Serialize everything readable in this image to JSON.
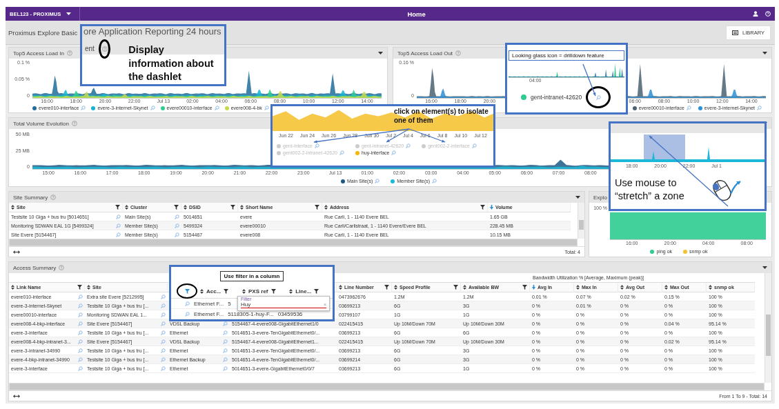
{
  "top_bar": {
    "account": "BEL123 - PROXIMUS",
    "title": "Home"
  },
  "page_header": {
    "title": "Proximus Explore Basic",
    "library_button": "LIBRARY"
  },
  "load_charts": [
    {
      "title": "Top5 Access Load In",
      "y_ticks": [
        "0.1 %",
        "0.05 %",
        "0"
      ],
      "x_ticks": [
        "16:00",
        "18:00",
        "20:00",
        "22:00",
        "Jul 13",
        "02:00",
        "04:00",
        "06:00",
        "08:00",
        "10:00",
        "12:00",
        "14:00"
      ],
      "legend": [
        {
          "label": "evere010-interface",
          "color": "#1f6e9c"
        },
        {
          "label": "evere-3-internet-Skynet",
          "color": "#17b3d1"
        },
        {
          "label": "evere00010-interface",
          "color": "#2ecc8f"
        },
        {
          "label": "evere008-4-bk",
          "color": "#c8da4c"
        }
      ]
    },
    {
      "title": "Top5 Access Load Out",
      "y_ticks": [
        "0.16 %",
        "0"
      ],
      "x_ticks": [
        "16:00",
        "18:00",
        "20:00",
        "06:00",
        "08:00",
        "10:00",
        "12:00",
        "14:00"
      ],
      "legend": [
        {
          "label": "evere00010-interface",
          "color": "#4a6272"
        },
        {
          "label": "evere-3-internet-Skynet",
          "color": "#2b8fd6"
        }
      ]
    }
  ],
  "volume_chart": {
    "title": "Total Volume Evolution",
    "y_ticks": [
      "50 MB",
      "25 MB",
      "0"
    ],
    "x_ticks": [
      "15:00",
      "16:00",
      "17:00",
      "18:00",
      "19:00",
      "20:00",
      "21:00",
      "22:00",
      "23:00",
      "Jul 13",
      "01:00",
      "02:00",
      "03:00",
      "04:00",
      "05:00",
      "06:00",
      "07:00",
      "08:00"
    ],
    "legend": [
      {
        "label": "Main Site(s)",
        "color": "#1c5a85"
      },
      {
        "label": "Member Site(s)",
        "color": "#1bb8d8"
      }
    ]
  },
  "site_summary": {
    "title": "Site Summary",
    "columns": [
      {
        "label": "Site",
        "sorted": false,
        "kind": "lookup"
      },
      {
        "label": "Cluster",
        "sorted": false,
        "kind": "lookup"
      },
      {
        "label": "DSID",
        "sorted": false,
        "kind": "filter"
      },
      {
        "label": "Short Name",
        "sorted": false,
        "kind": "filter"
      },
      {
        "label": "Address",
        "sorted": false,
        "kind": "filter"
      },
      {
        "label": "Volume",
        "sorted": true,
        "kind": "plain"
      }
    ],
    "rows": [
      [
        "Testsite 10 Giga + bus tru [5014651]",
        "Main Site(s)",
        "5014651",
        "evere",
        "Rue Carli, 1 - 1140 Evere BEL",
        "1.65 GB"
      ],
      [
        "Monitoring SDWAN EAL 1G [5499324]",
        "Member Site(s)",
        "5499324",
        "evere00010",
        "Rue Carli/Carlistraat, 1 - 1140 Evere/Evere BEL",
        "228.45 MB"
      ],
      [
        "Site Evere [5154467]",
        "Member Site(s)",
        "5154467",
        "evere008",
        "Rue Carli, 1 - 1140 Evere BEL",
        "10.15 MB"
      ]
    ],
    "footer": "Total: 4"
  },
  "explore_chart": {
    "title": "Explo",
    "y_ticks": [
      "100 %"
    ],
    "x_ticks": [
      "16:00",
      "20:00",
      "04:00",
      "08:00"
    ],
    "legend": [
      {
        "label": "ping ok",
        "color": "#2ecc8f"
      },
      {
        "label": "snmp ok",
        "color": "#f2c230"
      }
    ]
  },
  "access_summary": {
    "title": "Access Summary",
    "group_header": "Bandwidth Utilization % [Average, Maximum (peak)]",
    "columns": [
      {
        "label": "Link Name",
        "sorted": false,
        "kind": "lookup"
      },
      {
        "label": "Site",
        "sorted": false,
        "kind": "linked"
      },
      {
        "kind": "linked"
      },
      {
        "kind": "plain"
      },
      {
        "label": "Line Number",
        "sorted": false,
        "kind": "filter"
      },
      {
        "label": "Speed Profile",
        "sorted": false,
        "kind": "filter"
      },
      {
        "label": "Available BW",
        "sorted": false,
        "kind": "filter"
      },
      {
        "label": "Avg In",
        "sorted": true,
        "kind": "plain"
      },
      {
        "label": "Max In",
        "sorted": false,
        "kind": "plain"
      },
      {
        "label": "Avg Out",
        "sorted": false,
        "kind": "plain"
      },
      {
        "label": "Max Out",
        "sorted": false,
        "kind": "plain"
      },
      {
        "label": "snmp ok",
        "sorted": false,
        "kind": "plain"
      }
    ],
    "rows": [
      [
        "evere010-interface",
        "Extra site Evere [5212995]",
        null,
        null,
        "0473962676",
        "1.2M",
        "1.2M",
        "0.01 %",
        "0.07 %",
        "0.02 %",
        "0.15 %",
        "100 %"
      ],
      [
        "evere-3-internet-Skynet",
        "Testsite 10 Giga + bus tru [...",
        null,
        null,
        "03699213",
        "6G",
        "3G",
        "0 %",
        "0.01 %",
        "0 %",
        "0 %",
        "100 %"
      ],
      [
        "evere00010-interface",
        "Monitoring SDWAN EAL 1...",
        null,
        null,
        "03799107",
        "1G",
        "1G",
        "0 %",
        "0 %",
        "0 %",
        "0 %",
        "100 %"
      ],
      [
        "evere008-4-bkp-interface",
        "Site Evere [5154467]",
        "VDSL Backup",
        "5154467-4-evere008-GigabitEthernet1/0",
        "022415415",
        "Up 10M/Down 70M",
        "Up 10M/Down 30M",
        "0 %",
        "0 %",
        "0 %",
        "0.04 %",
        "95.14 %"
      ],
      [
        "evere-3-interface",
        "Testsite 10 Giga + bus tru [...",
        "Ethernet",
        "5014651-3-evere-TenGigabitEthernet0/...",
        "03699213",
        "6G",
        "6G",
        "0 %",
        "0 %",
        "0 %",
        "0 %",
        "100 %"
      ],
      [
        "evere008-4-bkp-intranet-3...",
        "Site Evere [5154467]",
        "VDSL Backup",
        "5154467-4-evere008-GigabitEthernet1...",
        "022415415",
        "Up 10M/Down 70M",
        "Up 10M/Down 30M",
        "0 %",
        "0 %",
        "0 %",
        "0.02 %",
        "95.14 %"
      ],
      [
        "evere-3-intranet-34990",
        "Testsite 10 Giga + bus tru [...",
        "Ethernet",
        "5014651-3-evere-TenGigabitEthernet0/...",
        "03699213",
        "6G",
        "3G",
        "0 %",
        "0 %",
        "0 %",
        "0 %",
        "100 %"
      ],
      [
        "evere-4-bkp-intranet-34990",
        "Testsite 10 Giga + bus tru [...",
        "Ethernet Backup",
        "5014651-4-evere-TenGigabitEthernet0/...",
        "03699214",
        "6G",
        "3G",
        "0 %",
        "0 %",
        "0 %",
        "0 %",
        "100 %"
      ],
      [
        "evere-3-interface",
        "Testsite 10 Giga + bus tru [...",
        "Ethernet",
        "5014651-3-evere-GigabitEthernet0/0/7",
        "03699213",
        "6G",
        "1G",
        "0 %",
        "0 %",
        "0 %",
        "0 %",
        "100 %"
      ]
    ],
    "footer": "From 1 To 9 - Total: 14"
  },
  "callouts": {
    "dashlet_info": {
      "cut_title": "ore Application Reporting 24 hours",
      "cut_header": "ent",
      "text": "Display information about the dashlet"
    },
    "drilldown": {
      "text": "Looking glass icon = drilldown feature",
      "x_tick": "04:00",
      "legend": [
        {
          "label": "gent-intranet-42620",
          "color": "#2ecc8f"
        }
      ]
    },
    "isolate": {
      "text": "click on element(s) to isolate one of them",
      "x_ticks": [
        "Jun 22",
        "Jun 24",
        "Jun 26",
        "Jun 28",
        "Jun 30",
        "Jul 2",
        "Jul 4",
        "Jul 6",
        "Jul 8",
        "Jul 10",
        "Jul 12"
      ],
      "legend": [
        {
          "label": "gent-interface",
          "selected": false
        },
        {
          "label": "gent-intranet-42620",
          "selected": false
        },
        {
          "label": "gent002-2-interface",
          "selected": false
        },
        {
          "label": "gent002-2-intranet-42620",
          "selected": false
        },
        {
          "label": "huy-interface",
          "selected": true
        }
      ]
    },
    "zoom": {
      "text": "Use mouse to “stretch” a zone",
      "x_ticks": [
        "18:00",
        "20:00",
        "22:00",
        "Jul 1"
      ]
    },
    "filter": {
      "text": "Use filter in a column",
      "columns": [
        "Acc...",
        "PXS ref",
        "Line..."
      ],
      "filter_label": "Filter",
      "filter_value": "Huy",
      "clear_symbol": "×",
      "rows": [
        [
          "Ethernet F...",
          "5"
        ],
        [
          "Ethernet F...",
          "5118305-1-huy-F...",
          "03459536"
        ]
      ]
    }
  }
}
